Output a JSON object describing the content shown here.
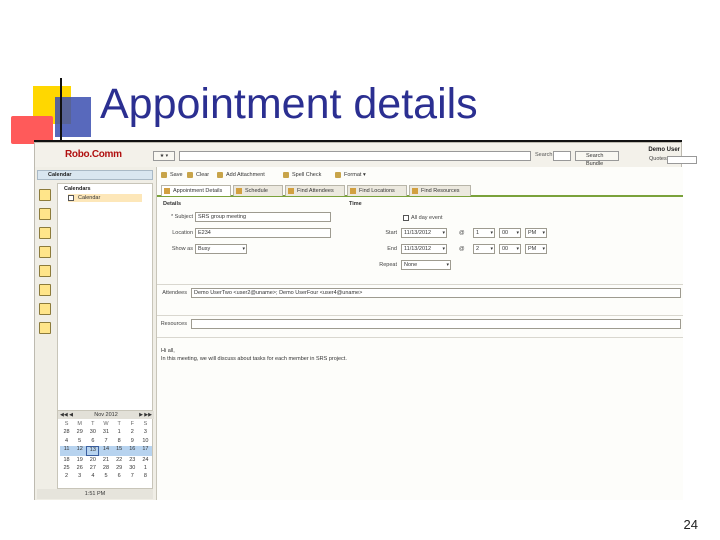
{
  "slide": {
    "title": "Appointment details",
    "page_number": "24"
  },
  "app": {
    "logo": "Robo.Comm",
    "user_name": "Demo User",
    "fav_label": "★ ▾",
    "search_label": "Search",
    "search_button": "Search Bundle",
    "quotes_label": "Quotes",
    "sidebar": {
      "header": "Calendar",
      "tree_root": "Calendars",
      "tree_child": "Calendar"
    },
    "minical": {
      "nav_left": "◀◀ ◀",
      "nav_right": "▶ ▶▶",
      "month": "Nov 2012",
      "dow": [
        "S",
        "M",
        "T",
        "W",
        "T",
        "F",
        "S"
      ],
      "weeks": [
        [
          "28",
          "29",
          "30",
          "31",
          "1",
          "2",
          "3"
        ],
        [
          "4",
          "5",
          "6",
          "7",
          "8",
          "9",
          "10"
        ],
        [
          "11",
          "12",
          "13",
          "14",
          "15",
          "16",
          "17"
        ],
        [
          "18",
          "19",
          "20",
          "21",
          "22",
          "23",
          "24"
        ],
        [
          "25",
          "26",
          "27",
          "28",
          "29",
          "30",
          "1"
        ],
        [
          "2",
          "3",
          "4",
          "5",
          "6",
          "7",
          "8"
        ]
      ],
      "status": "1:51 PM"
    },
    "toolbar": {
      "save": "Save",
      "clear": "Clear",
      "add_attachment": "Add Attachment",
      "spell_check": "Spell Check",
      "format": "Format ▾"
    },
    "tabs": {
      "appointment_details": "Appointment Details",
      "schedule": "Schedule",
      "find_attendees": "Find Attendees",
      "find_locations": "Find Locations",
      "find_resources": "Find Resources"
    },
    "details": {
      "title": "Details",
      "subject_label": "* Subject",
      "subject_value": "SRS group meeting",
      "location_label": "Location",
      "location_value": "E234",
      "show_as_label": "Show as",
      "show_as_value": "Busy"
    },
    "time": {
      "title": "Time",
      "all_day_label": "All day event",
      "start_label": "Start",
      "start_date": "11/13/2012",
      "start_hour": "1",
      "start_min": "00",
      "start_ampm": "PM",
      "end_label": "End",
      "end_date": "11/13/2012",
      "end_hour": "2",
      "end_min": "00",
      "end_ampm": "PM",
      "repeat_label": "Repeat",
      "repeat_value": "None"
    },
    "attendees_label": "Attendees",
    "attendees_value": "Demo UserTwo <user2@uname>; Demo UserFour <user4@uname>",
    "resources_label": "Resources",
    "notes": [
      "Hi all,",
      "In this meeting, we will discuss about tasks for each member in SRS project."
    ]
  }
}
